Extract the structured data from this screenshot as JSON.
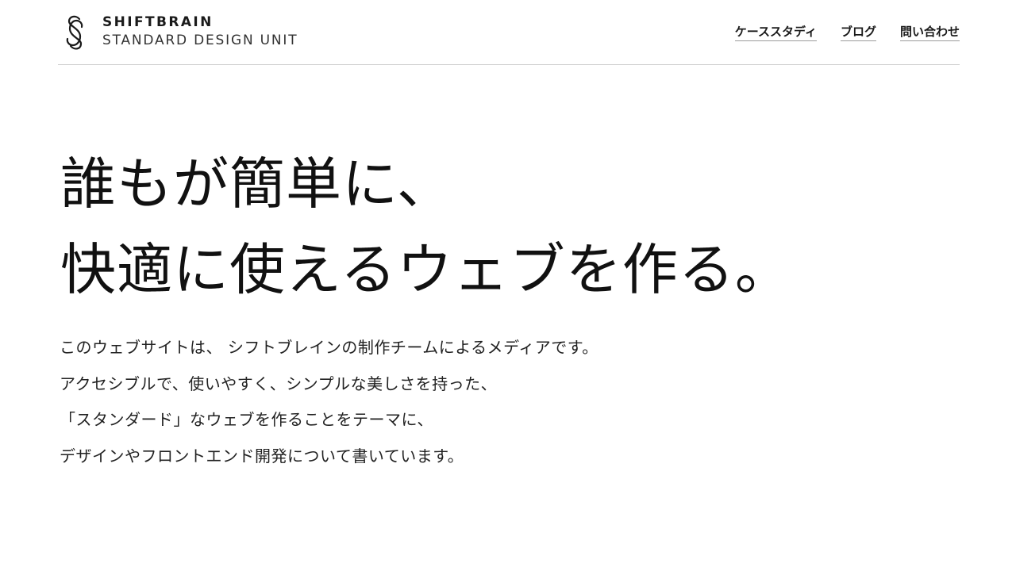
{
  "header": {
    "brand": {
      "icon": "shiftbrain-s-logo-icon",
      "name": "SHIFTBRAIN",
      "sub": "STANDARD DESIGN UNIT"
    },
    "nav": [
      {
        "label": "ケーススタディ"
      },
      {
        "label": "ブログ"
      },
      {
        "label": "問い合わせ"
      }
    ]
  },
  "hero": {
    "title_lines": [
      "誰もが簡単に、",
      "快適に使えるウェブを作る。"
    ],
    "description_lines": [
      "このウェブサイトは、 シフトブレインの制作チームによるメディアです。",
      "アクセシブルで、使いやすく、シンプルな美しさを持った、",
      "「スタンダード」なウェブを作ることをテーマに、",
      "デザインやフロントエンド開発について書いています。"
    ]
  }
}
